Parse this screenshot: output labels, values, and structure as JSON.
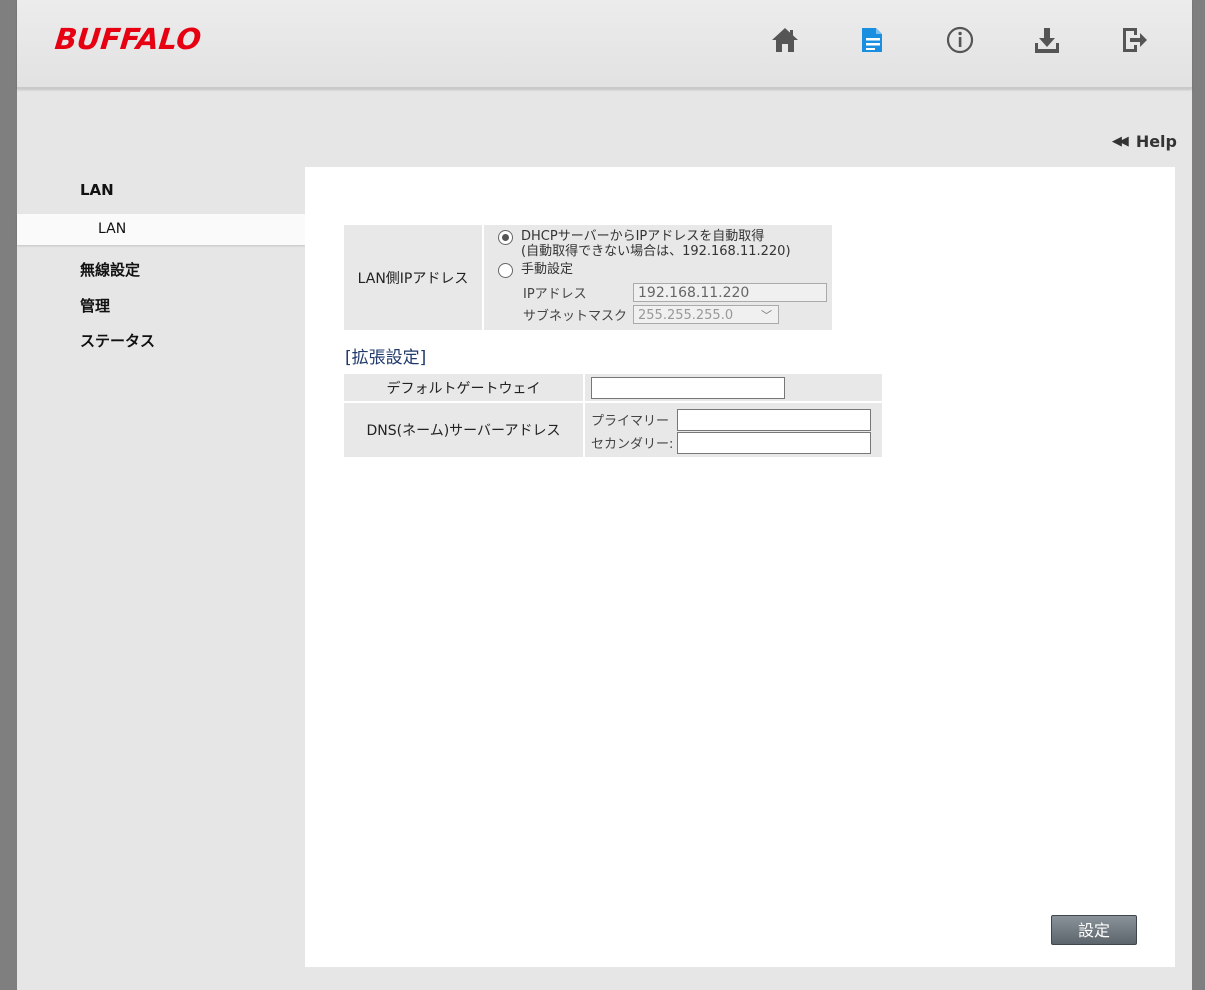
{
  "brand": {
    "logo_text": "BUFFALO",
    "color": "#e60012"
  },
  "header": {
    "icons": [
      {
        "name": "home-icon",
        "active": false
      },
      {
        "name": "settings-icon",
        "active": true,
        "color": "#1a8fe0"
      },
      {
        "name": "info-icon",
        "active": false
      },
      {
        "name": "download-icon",
        "active": false
      },
      {
        "name": "logout-icon",
        "active": false
      }
    ]
  },
  "help": {
    "label": "Help"
  },
  "sidebar": {
    "lan_heading": "LAN",
    "lan_sub": "LAN",
    "wireless": "無線設定",
    "admin": "管理",
    "status": "ステータス"
  },
  "lan_ip": {
    "label": "LAN側IPアドレス",
    "dhcp_option_line1": "DHCPサーバーからIPアドレスを自動取得",
    "dhcp_option_line2": "(自動取得できない場合は、192.168.11.220)",
    "manual_option": "手動設定",
    "selected": "dhcp",
    "ip_label": "IPアドレス",
    "ip_value": "192.168.11.220",
    "subnet_label": "サブネットマスク",
    "subnet_value": "255.255.255.0"
  },
  "advanced": {
    "title": "[拡張設定]",
    "gateway_label": "デフォルトゲートウェイ",
    "gateway_value": "",
    "dns_label": "DNS(ネーム)サーバーアドレス",
    "primary_label": "プライマリー",
    "primary_value": "",
    "secondary_label": "セカンダリー:",
    "secondary_value": ""
  },
  "actions": {
    "submit_label": "設定"
  }
}
